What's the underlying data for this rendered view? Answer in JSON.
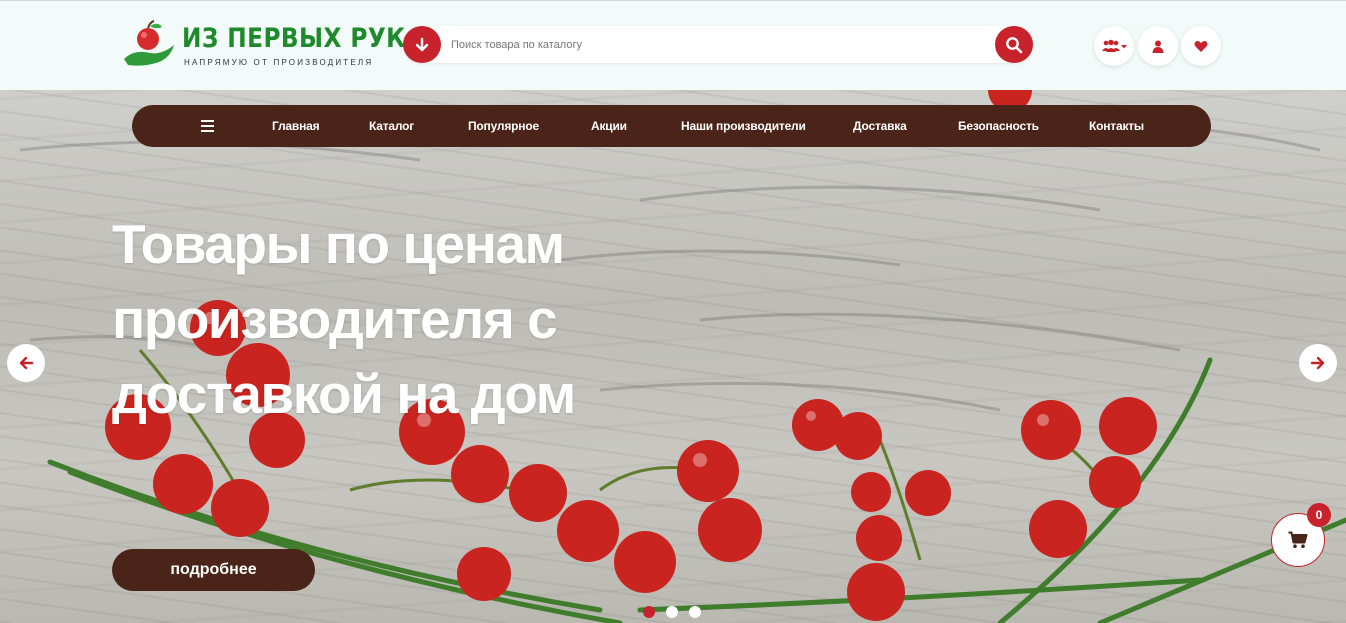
{
  "header": {
    "logo_title": "ИЗ ПЕРВЫХ РУК",
    "logo_subtitle": "НАПРЯМУЮ ОТ ПРОИЗВОДИТЕЛЯ",
    "search_placeholder": "Поиск товара по каталогу",
    "icons": [
      "arrow-down-icon",
      "search-icon",
      "users-dropdown-icon",
      "user-icon",
      "heart-icon"
    ]
  },
  "nav": {
    "items": [
      "Главная",
      "Каталог",
      "Популярное",
      "Акции",
      "Наши производители",
      "Доставка",
      "Безопасность",
      "Контакты"
    ]
  },
  "hero": {
    "title": "Товары по ценам производителя с доставкой на дом",
    "button_label": "подробнее",
    "slides_count": 3,
    "active_slide": 1
  },
  "cart": {
    "count": "0"
  },
  "colors": {
    "accent_red": "#c8232c",
    "nav_brown": "#4a2419",
    "logo_green": "#1f8a2b"
  }
}
